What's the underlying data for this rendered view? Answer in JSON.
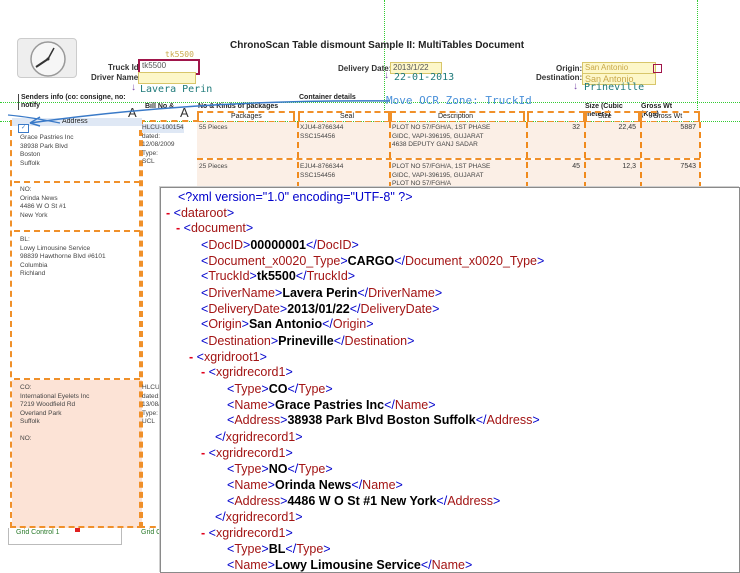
{
  "document_title": "ChronoScan Table dismount Sample II: MultiTables Document",
  "header_fields": {
    "truck_id_label": "Truck Id",
    "truck_id_value": "tk5500",
    "truck_id_ocr": "tk5500",
    "driver_name_label": "Driver Name:",
    "driver_name_ocr": "Lavera Perin",
    "delivery_date_label": "Delivery Date:",
    "delivery_date_value": "2013/1/22",
    "delivery_date_ocr": "22-01-2013",
    "origin_label": "Origin:",
    "origin_value": "San Antonio",
    "destination_label": "Destination:",
    "destination_value": "San Antonio",
    "destination_ocr": "Prineville",
    "move_ocr_zone": "Move OCR Zone: TruckId"
  },
  "table": {
    "headers": [
      "Senders info (co: consigne, no: notify",
      "Bill No &",
      "No & Kinds of packages",
      "Container details",
      "Description",
      "Gross",
      "Size (Cubic meters)",
      "Gross Wt (Kgs)"
    ],
    "subheaders": [
      "Address",
      "Packages",
      "Seal",
      "Description",
      "Size",
      "Gross Wt"
    ],
    "col_marker": "A",
    "senders": [
      {
        "type": "CO:",
        "name": "Grace Pastries Inc",
        "line1": "38938 Park Blvd",
        "line2": "Boston",
        "line3": "Suffolk"
      },
      {
        "type": "NO:",
        "name": "Orinda News",
        "line1": "4486 W O St #1",
        "line2": "New York",
        "line3": ""
      },
      {
        "type": "BL:",
        "name": "Lowy Limousine Service",
        "line1": "98839 Hawthorne Blvd #6101",
        "line2": "Columbia",
        "line3": "Richland"
      },
      {
        "type": "CO:",
        "name": "International Eyelets Inc",
        "line1": "7219 Woodfield Rd",
        "line2": "Overland Park",
        "line3": "Suffolk"
      },
      {
        "type": "NO:",
        "name": "",
        "line1": "",
        "line2": "",
        "line3": ""
      }
    ],
    "bills": [
      {
        "no": "HLCU-100154",
        "dated": "dated:",
        "date": "12/08/2009",
        "type_label": "Type:",
        "type": "SCL"
      },
      {
        "no": "HLCU-",
        "dated": "dated:",
        "date": "13/08/",
        "type_label": "Type:",
        "type": "UCL"
      }
    ],
    "rows": [
      {
        "packages": "55 Pieces",
        "container": "XJU4-8766344",
        "seal": "SSC154456",
        "desc1": "PLOT NO 57/FGH/A, 1ST PHASE",
        "desc2": "GIDC, VAPI-396195, GUJARAT",
        "desc3": "4638 DEPUTY GANJ SADAR",
        "gross": "32",
        "size": "22,45",
        "weight": "5887"
      },
      {
        "packages": "25 Pieces",
        "container": "EJU4-8766344",
        "seal": "SSC154456",
        "desc1": "PLOT NO 57/FGH/A, 1ST PHASE",
        "desc2": "GIDC, VAPI-396195, GUJARAT",
        "desc3": "PLOT NO 57/FGH/A",
        "gross": "45",
        "size": "12,3",
        "weight": "7543"
      }
    ],
    "grid_controls": [
      "Grid Control 1",
      "Grid Co"
    ]
  },
  "xml": {
    "declaration": "<?xml version=\"1.0\" encoding=\"UTF-8\" ?>",
    "root": "dataroot",
    "document": "document",
    "fields": [
      {
        "tag": "DocID",
        "value": "00000001"
      },
      {
        "tag": "Document_x0020_Type",
        "value": "CARGO"
      },
      {
        "tag": "TruckId",
        "value": "tk5500"
      },
      {
        "tag": "DriverName",
        "value": "Lavera Perin"
      },
      {
        "tag": "DeliveryDate",
        "value": "2013/01/22"
      },
      {
        "tag": "Origin",
        "value": "San Antonio"
      },
      {
        "tag": "Destination",
        "value": "Prineville"
      }
    ],
    "grid_root": "xgridroot1",
    "grid_record": "xgridrecord1",
    "records": [
      {
        "Type": "CO",
        "Name": "Grace Pastries Inc",
        "Address": "38938 Park Blvd Boston Suffolk"
      },
      {
        "Type": "NO",
        "Name": "Orinda News",
        "Address": "4486 W O St #1 New York"
      },
      {
        "Type": "BL",
        "Name": "Lowy Limousine Service",
        "Address": "98839 Hawthorne Blvd #6101 Columbia Richland"
      }
    ],
    "tags": {
      "type": "Type",
      "name": "Name",
      "address": "Address"
    },
    "expander": "-"
  },
  "colors": {
    "orange_dash": "#f0902a",
    "tag_color": "#a31515",
    "bracket_color": "#0000cc",
    "ocr_teal": "#1f7a7a",
    "selection_red": "#a0154a"
  }
}
